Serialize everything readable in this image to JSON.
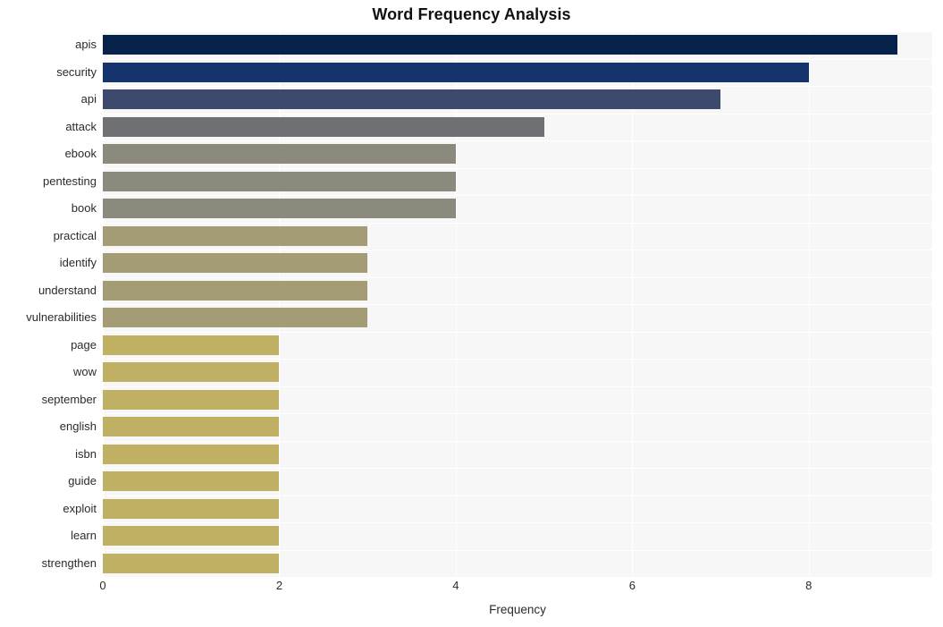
{
  "chart_data": {
    "type": "bar",
    "orientation": "horizontal",
    "title": "Word Frequency Analysis",
    "xlabel": "Frequency",
    "ylabel": "",
    "xlim": [
      0,
      9.4
    ],
    "xticks": [
      0,
      2,
      4,
      6,
      8
    ],
    "xtick_labels": [
      "0",
      "2",
      "4",
      "6",
      "8"
    ],
    "grid": true,
    "grid_axis": "x",
    "legend": false,
    "categories": [
      "apis",
      "security",
      "api",
      "attack",
      "ebook",
      "pentesting",
      "book",
      "practical",
      "identify",
      "understand",
      "vulnerabilities",
      "page",
      "wow",
      "september",
      "english",
      "isbn",
      "guide",
      "exploit",
      "learn",
      "strengthen"
    ],
    "values": [
      9,
      8,
      7,
      5,
      4,
      4,
      4,
      3,
      3,
      3,
      3,
      2,
      2,
      2,
      2,
      2,
      2,
      2,
      2,
      2
    ],
    "bar_colors": [
      "#06224a",
      "#15346e",
      "#3d4a6e",
      "#6e7073",
      "#8b8a7c",
      "#8b8a7c",
      "#8b8a7c",
      "#a39c74",
      "#a39c74",
      "#a39c74",
      "#a39c74",
      "#c0b064",
      "#c0b064",
      "#c0b064",
      "#c0b064",
      "#c0b064",
      "#c0b064",
      "#c0b064",
      "#c0b064",
      "#c0b064"
    ]
  },
  "style": {
    "plot_background": "#f7f7f7",
    "figure_background": "#ffffff",
    "gridline_color": "#ffffff",
    "tick_label_color": "#2b2b2b",
    "title_color": "#111111"
  }
}
